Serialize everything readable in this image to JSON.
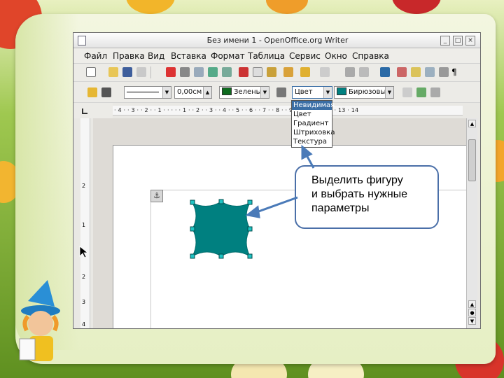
{
  "window": {
    "title": "Без имени 1 - OpenOffice.org Writer",
    "controls": [
      "_",
      "□",
      "×"
    ]
  },
  "menu": [
    "Файл",
    "Правка",
    "Вид",
    "Вставка",
    "Формат",
    "Таблица",
    "Сервис",
    "Окно",
    "Справка"
  ],
  "drawing_toolbar": {
    "line_width": "0,00см",
    "line_color": "Зеленый",
    "area_style": "Цвет",
    "area_fill": "Бирюзовый",
    "colors": {
      "line": "#0d6b1e",
      "area": "#008080"
    }
  },
  "area_style_dropdown": {
    "options": [
      "Невидимая",
      "Цвет",
      "Градиент",
      "Штриховка",
      "Текстура"
    ],
    "selected": "Невидимая"
  },
  "ruler": {
    "horizontal": "· 4 · · 3 · · 2 · · 1 · · ·   · · 1 · · 2 · · 3 · · 4 · · 5 · · 6 · · 7 · · 8 · · 9 · 10 · 11 · 12 · 13 · 14",
    "vertical": [
      "2",
      "1",
      "1",
      "2",
      "3",
      "4"
    ]
  },
  "callout": {
    "text": "Выделить фигуру\n и выбрать нужные\nпараметры"
  },
  "shape": {
    "type": "hexagram-star",
    "fill": "#008080"
  }
}
